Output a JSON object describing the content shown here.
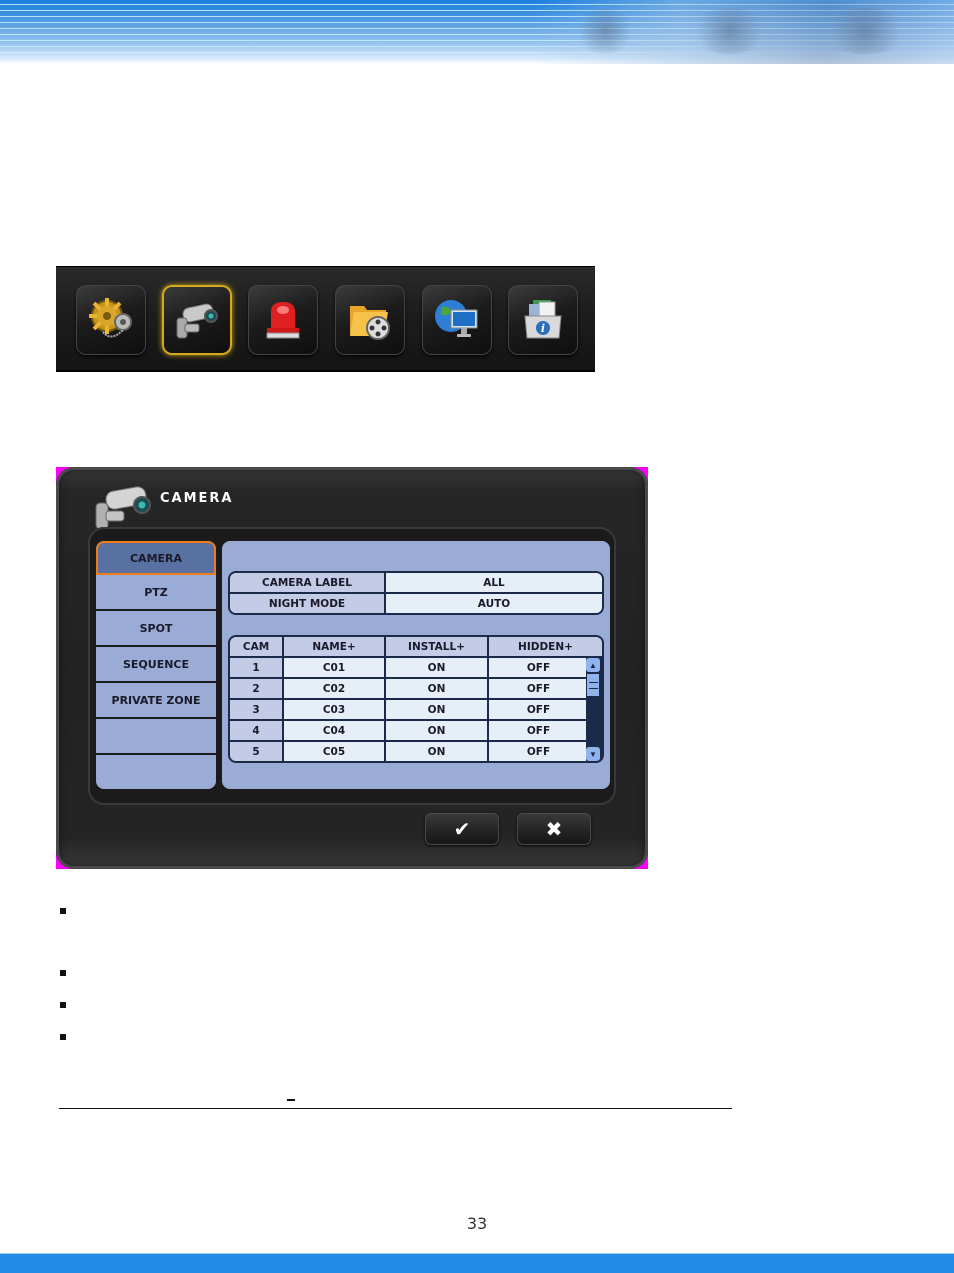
{
  "header": {
    "banner": "decorative-banner"
  },
  "menu_bar": {
    "items": [
      {
        "name": "setup",
        "icon": "gear-icon",
        "active": false
      },
      {
        "name": "camera",
        "icon": "camera-icon",
        "active": true
      },
      {
        "name": "event",
        "icon": "alarm-siren-icon",
        "active": false
      },
      {
        "name": "search",
        "icon": "folder-film-icon",
        "active": false
      },
      {
        "name": "network",
        "icon": "globe-monitor-icon",
        "active": false
      },
      {
        "name": "info",
        "icon": "info-box-icon",
        "active": false
      }
    ]
  },
  "dialog": {
    "title": "CAMERA",
    "sidebar": {
      "items": [
        {
          "label": "CAMERA",
          "active": true
        },
        {
          "label": "PTZ",
          "active": false
        },
        {
          "label": "SPOT",
          "active": false
        },
        {
          "label": "SEQUENCE",
          "active": false
        },
        {
          "label": "PRIVATE ZONE",
          "active": false
        },
        {
          "label": "",
          "active": false
        },
        {
          "label": "",
          "active": false
        }
      ]
    },
    "settings": [
      {
        "key": "CAMERA LABEL",
        "value": "ALL"
      },
      {
        "key": "NIGHT MODE",
        "value": "AUTO"
      }
    ],
    "table": {
      "headers": [
        "CAM",
        "NAME+",
        "INSTALL+",
        "HIDDEN+"
      ],
      "rows": [
        [
          "1",
          "C01",
          "ON",
          "OFF"
        ],
        [
          "2",
          "C02",
          "ON",
          "OFF"
        ],
        [
          "3",
          "C03",
          "ON",
          "OFF"
        ],
        [
          "4",
          "C04",
          "ON",
          "OFF"
        ],
        [
          "5",
          "C05",
          "ON",
          "OFF"
        ]
      ]
    },
    "buttons": {
      "ok_symbol": "✔",
      "cancel_symbol": "✖"
    }
  },
  "body": {
    "bullet_count": 4,
    "dash": "–"
  },
  "footer": {
    "page_number": "33",
    "band_color": "#228be6"
  },
  "colors": {
    "panel_bg": "#9aabd6",
    "active_tab": "#5870a2",
    "active_border": "#ef7a1a",
    "active_menu_glow": "#d4aa20"
  }
}
